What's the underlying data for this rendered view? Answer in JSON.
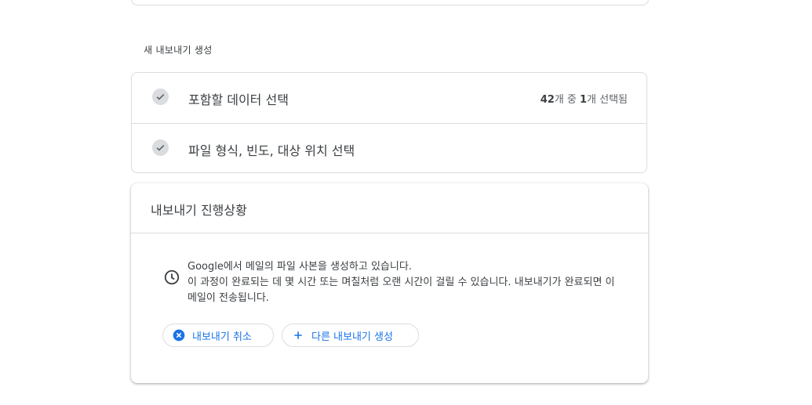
{
  "section": {
    "heading": "새 내보내기 생성"
  },
  "steps": [
    {
      "label": "포함할 데이터 선택",
      "status_count": "42",
      "status_mid": "개 중 ",
      "status_selected": "1",
      "status_tail": "개 선택됨"
    },
    {
      "label": "파일 형식, 빈도, 대상 위치 선택"
    }
  ],
  "progress": {
    "title": "내보내기 진행상황",
    "message_line1": "Google에서 메일의 파일 사본을 생성하고 있습니다.",
    "message_line2": "이 과정이 완료되는 데 몇 시간 또는 며칠처럼 오랜 시간이 걸릴 수 있습니다. 내보내기가 완료되면 이메일이 전송됩니다.",
    "cancel_label": "내보내기 취소",
    "create_label": "다른 내보내기 생성"
  },
  "colors": {
    "accent": "#1a73e8",
    "border": "#dadce0",
    "text": "#3c4043",
    "check_bg": "#dadce0"
  },
  "icons": {
    "step_check": "check-icon",
    "status": "clock-icon",
    "cancel": "cancel-circle-icon",
    "create": "plus-icon"
  }
}
